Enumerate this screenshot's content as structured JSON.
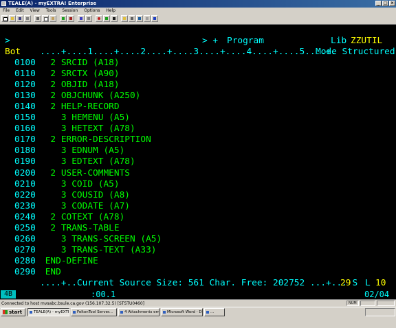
{
  "window": {
    "title": "TEALE(A) - myEXTRA! Enterprise",
    "controls": {
      "minimize": "_",
      "maximize": "□",
      "close": "×"
    }
  },
  "menu": [
    "File",
    "Edit",
    "View",
    "Tools",
    "Session",
    "Options",
    "Help"
  ],
  "toolbar_icons": [
    "new-icon",
    "open-icon",
    "save-icon",
    "print-icon",
    "cut-icon",
    "copy-icon",
    "paste-icon",
    "connect-icon",
    "disconnect-icon",
    "macro-icon",
    "keyboard-icon",
    "record-icon",
    "play-icon",
    "stop-icon",
    "ftp-icon",
    "settings-icon",
    "monitor-icon",
    "quickpad-icon",
    "help-icon"
  ],
  "terminal": {
    "header_prompt": ">",
    "header_cmd": "> +",
    "header_type": "Program",
    "header_lib_label": "Lib",
    "header_lib": "ZZUTIL",
    "ruler_left": "Bot",
    "ruler": "....+....1....+....2....+....3....+....4....+....5....+.",
    "ruler_mode": "Mode Structured.",
    "lines": [
      {
        "num": "0100",
        "code": "  2 SRCID (A18)"
      },
      {
        "num": "0110",
        "code": "  2 SRCTX (A90)"
      },
      {
        "num": "0120",
        "code": "  2 OBJID (A18)"
      },
      {
        "num": "0130",
        "code": "  2 OBJCHUNK (A250)"
      },
      {
        "num": "0140",
        "code": "  2 HELP-RECORD"
      },
      {
        "num": "0150",
        "code": "    3 HEMENU (A5)"
      },
      {
        "num": "0160",
        "code": "    3 HETEXT (A78)"
      },
      {
        "num": "0170",
        "code": "  2 ERROR-DESCRIPTION"
      },
      {
        "num": "0180",
        "code": "    3 EDNUM (A5)"
      },
      {
        "num": "0190",
        "code": "    3 EDTEXT (A78)"
      },
      {
        "num": "0200",
        "code": "  2 USER-COMMENTS"
      },
      {
        "num": "0210",
        "code": "    3 COID (A5)"
      },
      {
        "num": "0220",
        "code": "    3 COUSID (A8)"
      },
      {
        "num": "0230",
        "code": "    3 CODATE (A7)"
      },
      {
        "num": "0240",
        "code": "  2 COTEXT (A78)"
      },
      {
        "num": "0250",
        "code": "  2 TRANS-TABLE"
      },
      {
        "num": "0260",
        "code": "    3 TRANS-SCREEN (A5)"
      },
      {
        "num": "0270",
        "code": "    3 TRANS-TEXT (A33)"
      },
      {
        "num": "0280",
        "code": " END-DEFINE"
      },
      {
        "num": "0290",
        "code": " END"
      }
    ],
    "footer_text": "....+..Current Source Size: 561 Char. Free: 202752 ...+... S",
    "footer_s_value": "29",
    "footer_l_label": "L",
    "footer_l_value": "10"
  },
  "oia": {
    "indicator": "4B",
    "clock": ":00.1",
    "cursor": "02/04"
  },
  "statusbar": {
    "message": "Connected to host mvsabc.bsule.ca.gov (156.107.32.5) [STSTU0460]",
    "cells": [
      "NUM",
      "",
      ""
    ]
  },
  "taskbar": {
    "start_label": "start",
    "tasks": [
      {
        "label": "TEALE(A) - myEXTRA!...",
        "active": true
      },
      {
        "label": "FeltonTool Server...",
        "active": false
      },
      {
        "label": "4 Attachments emai...",
        "active": false
      },
      {
        "label": "Microsoft Word - Doc...",
        "active": false
      },
      {
        "label": "...",
        "active": false
      }
    ],
    "clock": ""
  }
}
